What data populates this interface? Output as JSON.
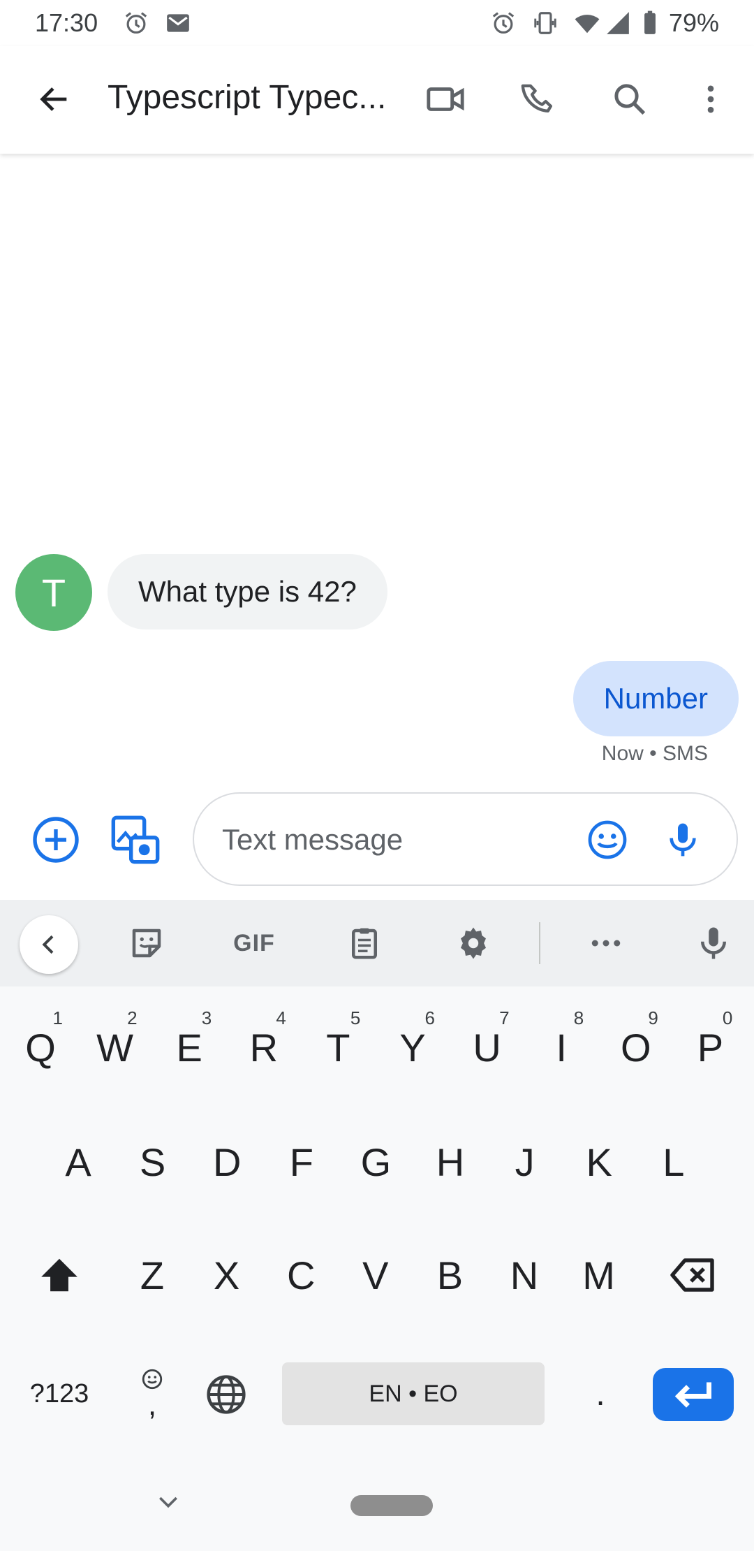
{
  "status_bar": {
    "time": "17:30",
    "battery": "79%",
    "icons": [
      "alarm-icon",
      "gmail-icon",
      "alarm-icon",
      "vibrate-icon",
      "wifi-icon",
      "signal-icon",
      "battery-icon"
    ]
  },
  "app_bar": {
    "title": "Typescript Typec...",
    "icons": [
      "back-arrow-icon",
      "video-call-icon",
      "phone-icon",
      "search-icon",
      "more-vert-icon"
    ]
  },
  "conversation": {
    "avatar_initial": "T",
    "avatar_color": "#5bb974",
    "incoming": {
      "text": "What type is 42?"
    },
    "outgoing": {
      "text": "Number",
      "meta": "Now • SMS"
    }
  },
  "compose": {
    "placeholder": "Text message",
    "accent_color": "#1a73e8"
  },
  "keyboard": {
    "toolbar": {
      "gif_label": "GIF"
    },
    "row1": [
      {
        "label": "Q",
        "hint": "1"
      },
      {
        "label": "W",
        "hint": "2"
      },
      {
        "label": "E",
        "hint": "3"
      },
      {
        "label": "R",
        "hint": "4"
      },
      {
        "label": "T",
        "hint": "5"
      },
      {
        "label": "Y",
        "hint": "6"
      },
      {
        "label": "U",
        "hint": "7"
      },
      {
        "label": "I",
        "hint": "8"
      },
      {
        "label": "O",
        "hint": "9"
      },
      {
        "label": "P",
        "hint": "0"
      }
    ],
    "row2": [
      "A",
      "S",
      "D",
      "F",
      "G",
      "H",
      "J",
      "K",
      "L"
    ],
    "row3": [
      "Z",
      "X",
      "C",
      "V",
      "B",
      "N",
      "M"
    ],
    "symbols_label": "?123",
    "comma_label": ",",
    "space_label": "EN • EO",
    "period_label": "."
  }
}
